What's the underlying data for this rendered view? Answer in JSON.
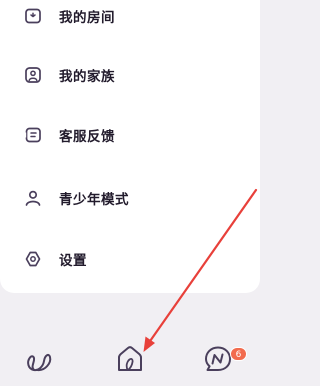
{
  "menu": {
    "items": [
      {
        "label": "我的房间",
        "icon": "room-icon"
      },
      {
        "label": "我的家族",
        "icon": "family-icon"
      },
      {
        "label": "客服反馈",
        "icon": "feedback-icon"
      },
      {
        "label": "青少年模式",
        "icon": "person-icon"
      },
      {
        "label": "设置",
        "icon": "settings-icon"
      }
    ]
  },
  "tabbar": {
    "tabs": [
      {
        "icon": "moments-icon"
      },
      {
        "icon": "home-icon"
      },
      {
        "icon": "messages-icon",
        "badge": "6"
      }
    ]
  },
  "colors": {
    "icon_stroke": "#4a3f5c",
    "badge": "#f26b4e",
    "annotation_arrow": "#e8403a",
    "background": "#f1eff3"
  }
}
